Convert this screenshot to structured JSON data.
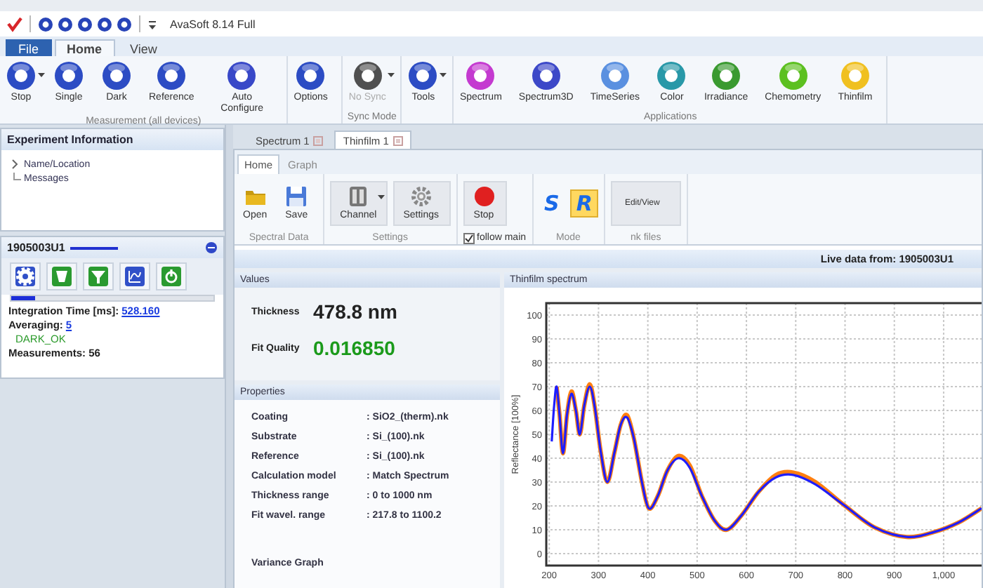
{
  "title_bar": {
    "title": "AvaSoft 8.14 Full"
  },
  "menu_tabs": [
    {
      "label": "File",
      "kind": "file",
      "selected": false
    },
    {
      "label": "Home",
      "kind": "tab",
      "selected": true
    },
    {
      "label": "View",
      "kind": "tab",
      "selected": false
    }
  ],
  "ribbon": {
    "groups": [
      {
        "label": "Measurement (all devices)",
        "buttons": [
          {
            "label": "Stop",
            "color": "#2c4cc4",
            "disabled": false,
            "dropdown": true
          },
          {
            "label": "Single",
            "color": "#2c4cc4",
            "disabled": false,
            "dropdown": false
          },
          {
            "label": "Dark",
            "color": "#2c4cc4",
            "disabled": false,
            "dropdown": false
          },
          {
            "label": "Reference",
            "color": "#2c4cc4",
            "disabled": false,
            "dropdown": false
          },
          {
            "label": "Auto Configure",
            "color": "#3848c8",
            "disabled": false,
            "dropdown": false
          }
        ]
      },
      {
        "buttons": [
          {
            "label": "Options",
            "color": "#2c4cc4",
            "disabled": false,
            "dropdown": false
          }
        ]
      },
      {
        "label": "Sync Mode",
        "buttons": [
          {
            "label": "No Sync",
            "color": "#505050",
            "disabled": true,
            "dropdown": true
          }
        ]
      },
      {
        "buttons": [
          {
            "label": "Tools",
            "color": "#2c4cc4",
            "disabled": false,
            "dropdown": true
          }
        ]
      },
      {
        "label": "Applications",
        "buttons": [
          {
            "label": "Spectrum",
            "color": "#c43ad0",
            "disabled": false,
            "dropdown": false
          },
          {
            "label": "Spectrum3D",
            "color": "#3c48c8",
            "disabled": false,
            "dropdown": false
          },
          {
            "label": "TimeSeries",
            "color": "#5a90e0",
            "disabled": false,
            "dropdown": false
          },
          {
            "label": "Color",
            "color": "#2898a8",
            "disabled": false,
            "dropdown": false
          },
          {
            "label": "Irradiance",
            "color": "#3a9a30",
            "disabled": false,
            "dropdown": false
          },
          {
            "label": "Chemometry",
            "color": "#5cc020",
            "disabled": false,
            "dropdown": false
          },
          {
            "label": "Thinfilm",
            "color": "#f0c020",
            "disabled": false,
            "dropdown": false
          }
        ]
      }
    ]
  },
  "experiment_panel": {
    "title": "Experiment Information",
    "tree": [
      {
        "label": "Name/Location",
        "has_children": true,
        "expanded": false
      },
      {
        "label": "Messages",
        "has_children": false
      }
    ]
  },
  "device_panel": {
    "title": "1905003U1",
    "tools": [
      {
        "kind": "gear",
        "color": "#3050c8"
      },
      {
        "kind": "cup",
        "color": "#2a9a30"
      },
      {
        "kind": "funnel",
        "color": "#2a9a30"
      },
      {
        "kind": "chart",
        "color": "#3050c8"
      },
      {
        "kind": "power",
        "color": "#2a9a30"
      }
    ],
    "progress": {
      "level": 0.12
    },
    "integration_label": "Integration Time  [ms]:",
    "integration_value": "528.160",
    "averaging_label": "Averaging:",
    "averaging_value": "5",
    "status": "DARK_OK",
    "measurements": "Measurements: 56"
  },
  "doc_tabs": [
    {
      "label": "Spectrum 1",
      "selected": false
    },
    {
      "label": "Thinfilm 1",
      "selected": true
    }
  ],
  "inner_tabs": [
    {
      "label": "Home",
      "selected": true
    },
    {
      "label": "Graph",
      "selected": false
    }
  ],
  "inner_ribbon": [
    {
      "label": "Spectral Data",
      "items": [
        {
          "kind": "open",
          "label": "Open",
          "dropdown": false
        },
        {
          "kind": "save",
          "label": "Save",
          "dropdown": false
        }
      ]
    },
    {
      "label": "Settings",
      "items": [
        {
          "kind": "channel",
          "label": "Channel",
          "dropdown": true
        },
        {
          "kind": "settings",
          "label": "Settings",
          "dropdown": false
        }
      ]
    },
    {
      "checkbox": {
        "label": "follow main",
        "checked": true
      },
      "items": [
        {
          "kind": "stop",
          "label": "Stop",
          "dropdown": false
        }
      ]
    },
    {
      "label": "Mode",
      "items": [
        {
          "kind": "mode",
          "label": "S",
          "selected": false
        },
        {
          "kind": "mode",
          "label": "R",
          "selected": true
        }
      ]
    },
    {
      "label": "nk files",
      "items": [
        {
          "kind": "text",
          "label": "Edit/View",
          "dropdown": false
        }
      ]
    }
  ],
  "live_bar": "Live data from: 1905003U1",
  "values_panel": {
    "title": "Values",
    "thickness_label": "Thickness",
    "thickness": "478.8 nm",
    "fit_label": "Fit Quality",
    "fit": "0.016850"
  },
  "properties_panel": {
    "title": "Properties",
    "rows": [
      {
        "name": "Coating",
        "value": ": SiO2_(therm).nk"
      },
      {
        "name": "Substrate",
        "value": ": Si_(100).nk"
      },
      {
        "name": "Reference",
        "value": ": Si_(100).nk"
      },
      {
        "name": "Calculation model",
        "value": ": Match Spectrum"
      },
      {
        "name": "Thickness range",
        "value": ": 0 to 1000 nm"
      },
      {
        "name": "Fit wavel. range",
        "value": ": 217.8 to 1100.2"
      }
    ],
    "variance_title": "Variance Graph"
  },
  "spectrum_panel": {
    "title": "Thinfilm spectrum",
    "chart_data": {
      "type": "line",
      "ylabel": "Reflectance [100%]",
      "x": [
        205,
        210,
        215,
        221,
        228,
        236,
        245,
        254,
        262,
        271,
        282,
        292,
        305,
        318,
        332,
        345,
        358,
        372,
        388,
        402,
        420,
        440,
        462,
        485,
        510,
        535,
        560,
        590,
        625,
        660,
        695,
        740,
        800,
        860,
        925,
        980,
        1030,
        1077
      ],
      "series": [
        {
          "color": "#ff7f10",
          "values": [
            null,
            null,
            70,
            58,
            42,
            58,
            68,
            60,
            50,
            62,
            71,
            62,
            42,
            30,
            42,
            54,
            58,
            48,
            30,
            19,
            24,
            35,
            41,
            37,
            24,
            14,
            10,
            16,
            26,
            33,
            34,
            30,
            20,
            11,
            7,
            9,
            13,
            19
          ]
        },
        {
          "color": "#1e1eff",
          "values": [
            47,
            62,
            70,
            58,
            42,
            58,
            67,
            60,
            50,
            62,
            70,
            62,
            42,
            30,
            42,
            54,
            57,
            48,
            30,
            19,
            24,
            35,
            40,
            36,
            24,
            14,
            10,
            16,
            26,
            32,
            33,
            29,
            20,
            11,
            7,
            9,
            13,
            19
          ]
        }
      ],
      "grid": true,
      "xlim": [
        194,
        1077
      ],
      "ylim": [
        -5,
        105
      ],
      "xticks": [
        200,
        300,
        400,
        500,
        600,
        700,
        800,
        900,
        {
          "value": 1000,
          "label": "1,000"
        }
      ],
      "yticks": [
        0,
        10,
        20,
        30,
        40,
        50,
        60,
        70,
        80,
        90,
        100
      ]
    }
  }
}
